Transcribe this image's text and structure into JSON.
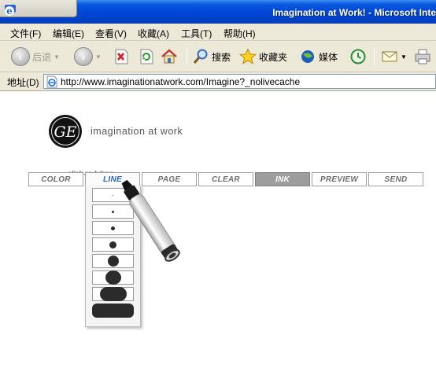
{
  "window": {
    "title": "Imagination at Work! - Microsoft Inte"
  },
  "menu": {
    "items": [
      "文件(F)",
      "编辑(E)",
      "查看(V)",
      "收藏(A)",
      "工具(T)",
      "帮助(H)"
    ]
  },
  "toolbar": {
    "back_label": "后退",
    "search_label": "搜索",
    "favorites_label": "收藏夹",
    "media_label": "媒体"
  },
  "address": {
    "label": "地址(D)",
    "url": "http://www.imaginationatwork.com/Imagine?_nolivecache"
  },
  "page": {
    "logo_text": "GE",
    "tagline": "imagination at work",
    "hint": "click and drag",
    "nav": [
      "COLOR",
      "LINE",
      "PAGE",
      "CLEAR",
      "INK",
      "PREVIEW",
      "SEND"
    ],
    "active_nav": "INK",
    "open_nav": "LINE",
    "line_widths_count": 8
  },
  "colors": {
    "titlebar": "#0046d5",
    "chrome": "#ece9d8",
    "ink_active": "#9d9d9d",
    "line_active": "#2a66c8"
  }
}
